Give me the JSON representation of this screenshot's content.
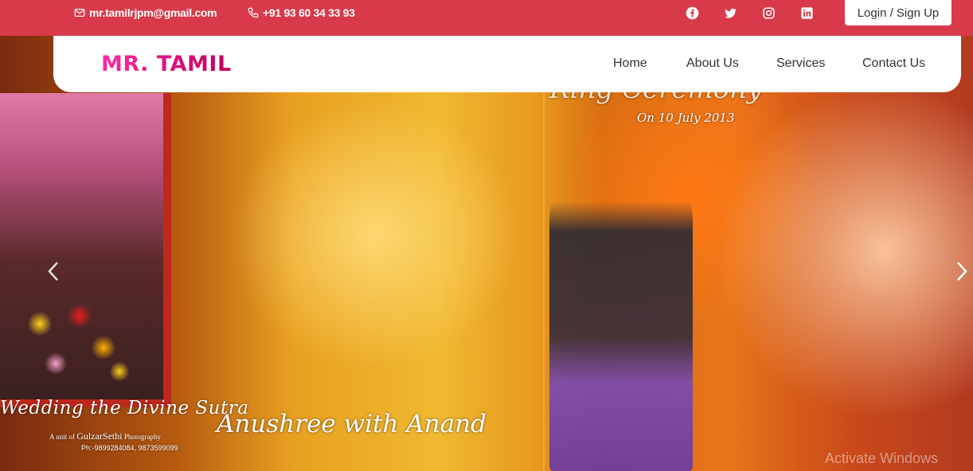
{
  "topbar": {
    "email": "mr.tamilrjpm@gmail.com",
    "phone": "+91 93 60 34 33 93",
    "social": [
      {
        "name": "facebook-icon"
      },
      {
        "name": "twitter-icon"
      },
      {
        "name": "instagram-icon"
      },
      {
        "name": "linkedin-icon"
      }
    ],
    "login_label": "Login / Sign Up",
    "accent_color": "#d83a4a"
  },
  "navbar": {
    "logo": "MR. TAMIL",
    "items": [
      "Home",
      "About Us",
      "Services",
      "Contact Us"
    ]
  },
  "hero": {
    "wedding_title": "Wedding the Divine Sutra",
    "unit_prefix": "A unit of",
    "unit_brand": "GulzarSethi",
    "unit_suffix": "Photography",
    "phones": "Ph:-9899284084, 9873599099",
    "couple_title": "Anushree with Anand",
    "ring_title": "Ring Ceremony",
    "date": "On 10 July 2013"
  },
  "watermark": "Activate Windows"
}
